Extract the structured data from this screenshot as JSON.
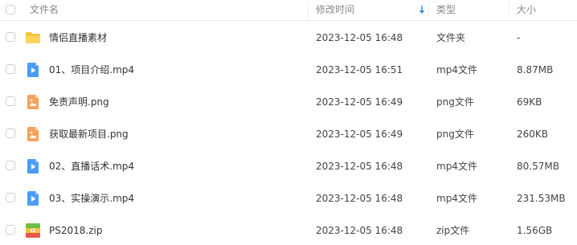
{
  "header": {
    "name_label": "文件名",
    "time_label": "修改时间",
    "type_label": "类型",
    "size_label": "大小"
  },
  "rows": [
    {
      "name": "情侣直播素材",
      "time": "2023-12-05 16:48",
      "type": "文件夹",
      "size": "-",
      "icon": "folder-icon"
    },
    {
      "name": "01、项目介绍.mp4",
      "time": "2023-12-05 16:51",
      "type": "mp4文件",
      "size": "8.87MB",
      "icon": "video-file-icon"
    },
    {
      "name": "免责声明.png",
      "time": "2023-12-05 16:49",
      "type": "png文件",
      "size": "69KB",
      "icon": "image-file-icon"
    },
    {
      "name": "获取最新项目.png",
      "time": "2023-12-05 16:49",
      "type": "png文件",
      "size": "260KB",
      "icon": "image-file-icon"
    },
    {
      "name": "02、直播话术.mp4",
      "time": "2023-12-05 16:48",
      "type": "mp4文件",
      "size": "80.57MB",
      "icon": "video-file-icon"
    },
    {
      "name": "03、实操演示.mp4",
      "time": "2023-12-05 16:48",
      "type": "mp4文件",
      "size": "231.53MB",
      "icon": "video-file-icon"
    },
    {
      "name": "PS2018.zip",
      "time": "2023-12-05 16:48",
      "type": "zip文件",
      "size": "1.56GB",
      "icon": "zip-file-icon"
    }
  ],
  "colors": {
    "folder": "#F9C23C",
    "video": "#4C9BF5",
    "image": "#F4A25A",
    "zip_top": "#6CC04A",
    "zip_mid": "#F5C242",
    "zip_bottom": "#E9584E",
    "sort_arrow": "#3B8BF0"
  }
}
